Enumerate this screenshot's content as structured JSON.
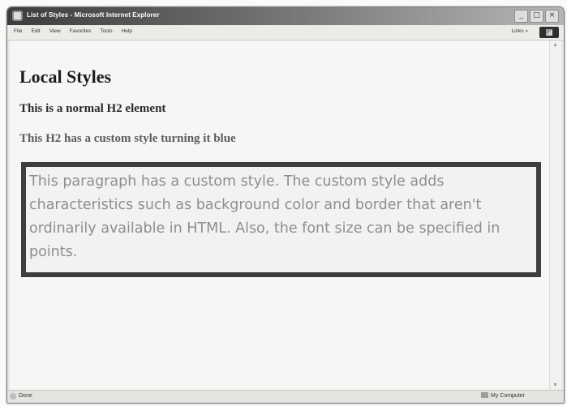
{
  "window": {
    "title": "List of Styles - Microsoft Internet Explorer",
    "controls": {
      "minimize": "_",
      "maximize": "□",
      "close": "×"
    }
  },
  "menubar": {
    "items": [
      "File",
      "Edit",
      "View",
      "Favorites",
      "Tools",
      "Help"
    ],
    "links": "Links"
  },
  "page": {
    "heading": "Local Styles",
    "normal_h2": "This is a normal H2 element",
    "custom_h2": "This H2 has a custom style turning it blue",
    "custom_paragraph": "This paragraph has a custom style. The custom style adds characteristics such as background color and border that aren't ordinarily available in HTML. Also, the font size can be specified in points."
  },
  "statusbar": {
    "status": "Done",
    "zone": "My Computer"
  },
  "icons": {
    "app": "ie-page-icon",
    "throbber": "windows-logo-icon",
    "status": "ie-status-icon",
    "zone": "computer-icon"
  }
}
